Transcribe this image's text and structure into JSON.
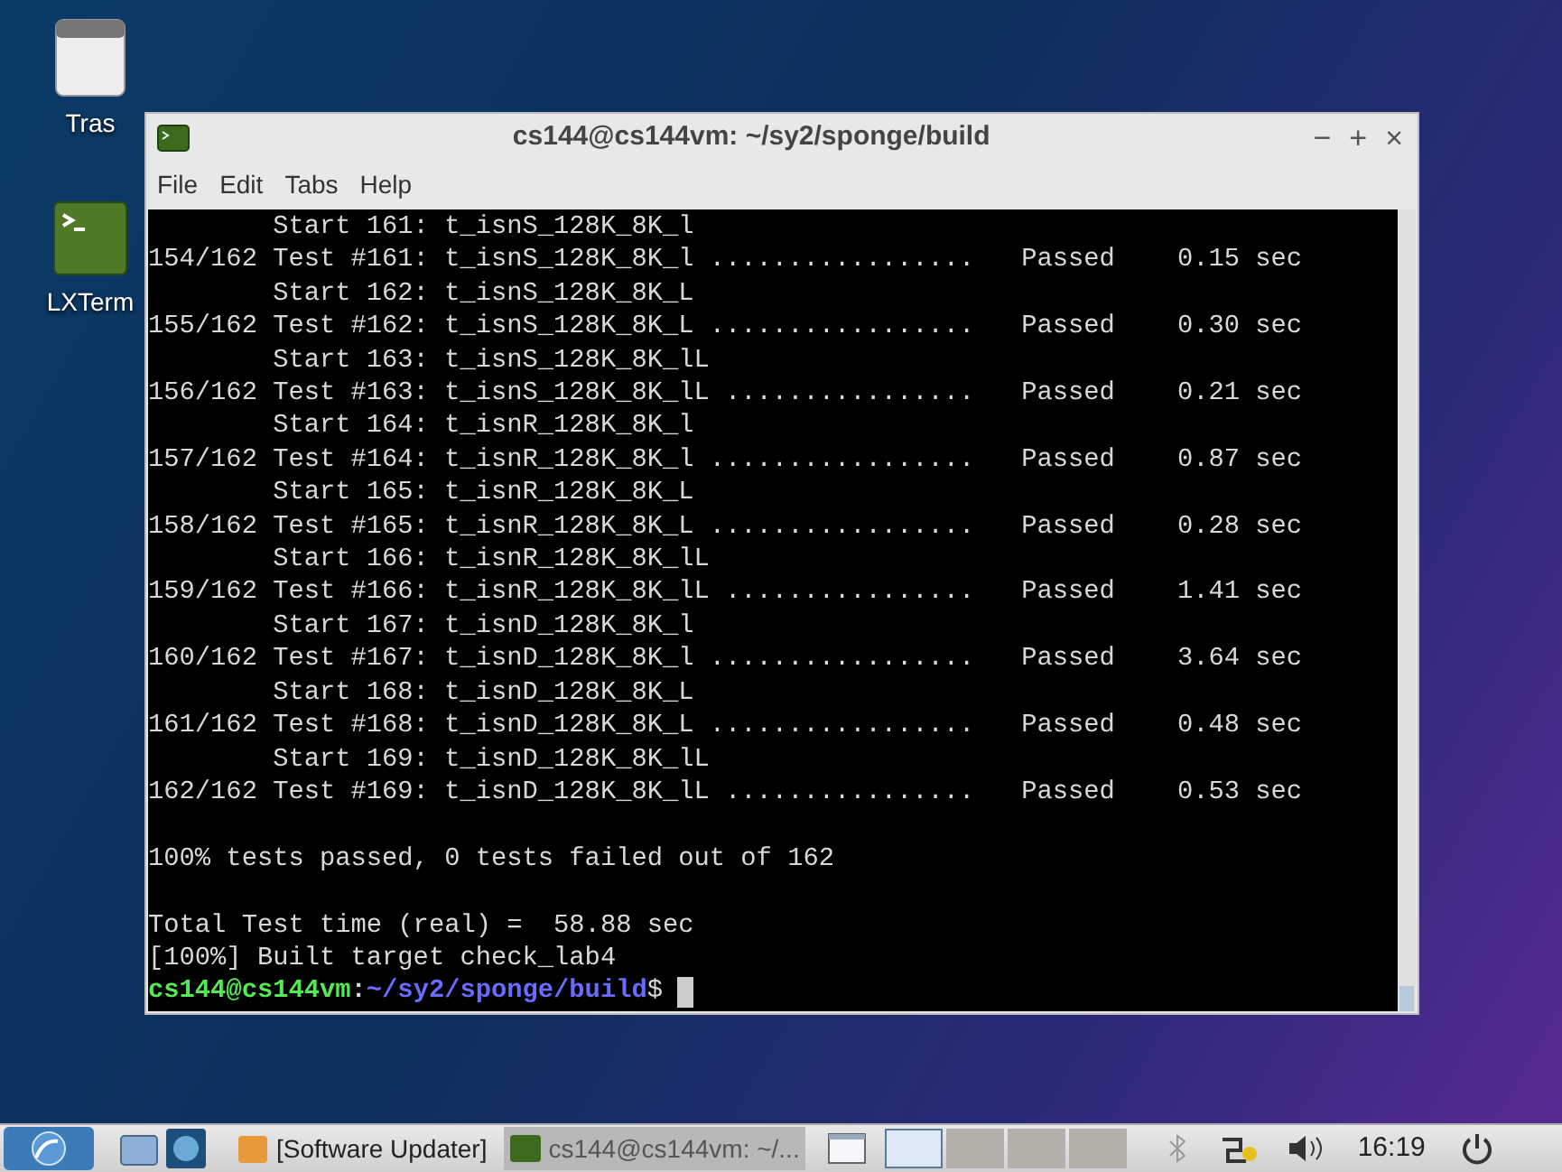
{
  "desktop_icons": [
    {
      "label": "Tras",
      "kind": "trash"
    },
    {
      "label": "LXTerm",
      "kind": "terminal"
    }
  ],
  "window": {
    "title": "cs144@cs144vm: ~/sy2/sponge/build",
    "controls": [
      "−",
      "+",
      "×"
    ]
  },
  "menu": [
    "File",
    "Edit",
    "Tabs",
    "Help"
  ],
  "terminal": {
    "lines": [
      {
        "kind": "text",
        "text": "        Start 161: t_isnS_128K_8K_l"
      },
      {
        "kind": "text",
        "text": "154/162 Test #161: t_isnS_128K_8K_l .................   Passed    0.15 sec"
      },
      {
        "kind": "text",
        "text": "        Start 162: t_isnS_128K_8K_L"
      },
      {
        "kind": "text",
        "text": "155/162 Test #162: t_isnS_128K_8K_L .................   Passed    0.30 sec"
      },
      {
        "kind": "text",
        "text": "        Start 163: t_isnS_128K_8K_lL"
      },
      {
        "kind": "text",
        "text": "156/162 Test #163: t_isnS_128K_8K_lL ................   Passed    0.21 sec"
      },
      {
        "kind": "text",
        "text": "        Start 164: t_isnR_128K_8K_l"
      },
      {
        "kind": "text",
        "text": "157/162 Test #164: t_isnR_128K_8K_l .................   Passed    0.87 sec"
      },
      {
        "kind": "text",
        "text": "        Start 165: t_isnR_128K_8K_L"
      },
      {
        "kind": "text",
        "text": "158/162 Test #165: t_isnR_128K_8K_L .................   Passed    0.28 sec"
      },
      {
        "kind": "text",
        "text": "        Start 166: t_isnR_128K_8K_lL"
      },
      {
        "kind": "text",
        "text": "159/162 Test #166: t_isnR_128K_8K_lL ................   Passed    1.41 sec"
      },
      {
        "kind": "text",
        "text": "        Start 167: t_isnD_128K_8K_l"
      },
      {
        "kind": "text",
        "text": "160/162 Test #167: t_isnD_128K_8K_l .................   Passed    3.64 sec"
      },
      {
        "kind": "text",
        "text": "        Start 168: t_isnD_128K_8K_L"
      },
      {
        "kind": "text",
        "text": "161/162 Test #168: t_isnD_128K_8K_L .................   Passed    0.48 sec"
      },
      {
        "kind": "text",
        "text": "        Start 169: t_isnD_128K_8K_lL"
      },
      {
        "kind": "text",
        "text": "162/162 Test #169: t_isnD_128K_8K_lL ................   Passed    0.53 sec"
      },
      {
        "kind": "blank"
      },
      {
        "kind": "text",
        "text": "100% tests passed, 0 tests failed out of 162"
      },
      {
        "kind": "blank"
      },
      {
        "kind": "text",
        "text": "Total Test time (real) =  58.88 sec"
      },
      {
        "kind": "text",
        "text": "[100%] Built target check_lab4"
      }
    ],
    "prompt": {
      "user": "cs144@cs144vm",
      "separator": ":",
      "path": "~/sy2/sponge/build",
      "symbol": "$"
    }
  },
  "taskbar": {
    "tasks": [
      {
        "label": "[Software Updater]",
        "kind": "updater",
        "selected": false
      },
      {
        "label": "cs144@cs144vm: ~/...",
        "kind": "terminal",
        "selected": true
      }
    ],
    "workspaces": [
      {
        "selected": true
      },
      {
        "selected": false
      },
      {
        "selected": false
      },
      {
        "selected": false
      }
    ],
    "clock": "16:19"
  }
}
